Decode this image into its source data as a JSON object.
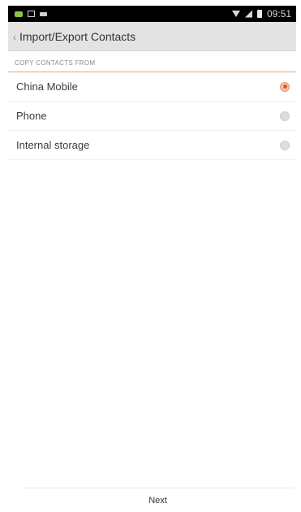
{
  "status_bar": {
    "time": "09:51",
    "left_icons": [
      "chat-icon",
      "picture-icon",
      "message-icon"
    ],
    "right_icons": [
      "wifi-icon",
      "signal-icon",
      "battery-icon"
    ]
  },
  "header": {
    "back_glyph": "‹",
    "title": "Import/Export Contacts"
  },
  "section": {
    "title": "COPY CONTACTS FROM"
  },
  "options": [
    {
      "label": "China Mobile",
      "selected": true
    },
    {
      "label": "Phone",
      "selected": false
    },
    {
      "label": "Internal storage",
      "selected": false
    }
  ],
  "footer": {
    "next_label": "Next"
  },
  "colors": {
    "accent": "#d3573a",
    "divider_accent": "#f0a582",
    "header_bg": "#e3e3e3",
    "status_bg": "#000000"
  }
}
